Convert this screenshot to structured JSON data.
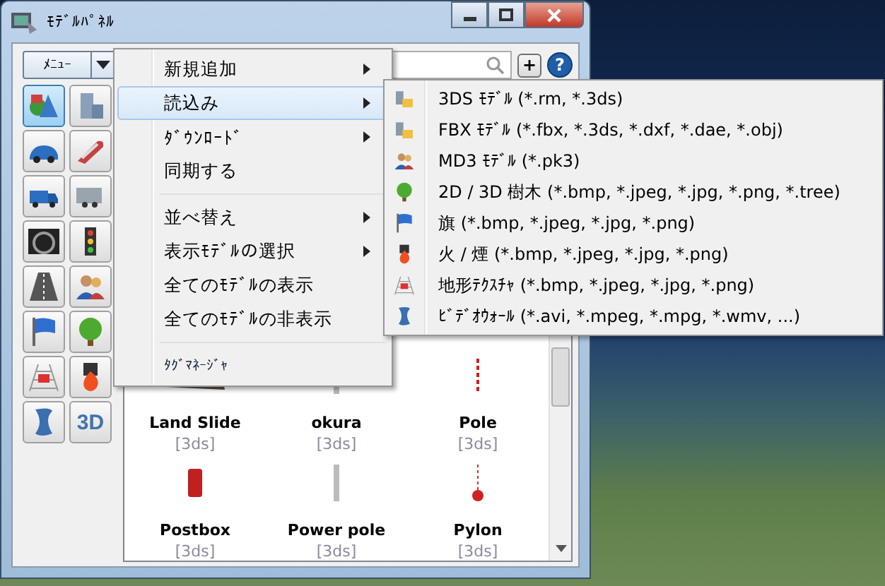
{
  "window": {
    "title": "ﾓﾃﾞﾙﾊﾟﾈﾙ"
  },
  "menu_button": {
    "label": "ﾒﾆｭｰ"
  },
  "toolbar": [
    {
      "selected": true
    },
    {
      "selected": false
    },
    {
      "selected": false
    },
    {
      "selected": false
    },
    {
      "selected": false
    },
    {
      "selected": false
    },
    {
      "selected": false
    },
    {
      "selected": false
    },
    {
      "selected": false
    },
    {
      "selected": false
    },
    {
      "selected": false
    },
    {
      "selected": false
    },
    {
      "selected": false
    },
    {
      "selected": false
    },
    {
      "selected": false
    },
    {
      "selected": false,
      "label": "3D"
    }
  ],
  "search_actions": [
    {
      "label": "+"
    },
    {
      "label": "?"
    }
  ],
  "models": [
    {
      "name": "Land Slide",
      "format": "[3ds]"
    },
    {
      "name": "okura",
      "format": "[3ds]"
    },
    {
      "name": "Pole",
      "format": "[3ds]"
    },
    {
      "name": "Postbox",
      "format": "[3ds]"
    },
    {
      "name": "Power pole",
      "format": "[3ds]"
    },
    {
      "name": "Pylon",
      "format": "[3ds]"
    }
  ],
  "context_menu": [
    {
      "kind": "item",
      "label": "新規追加",
      "submenu": true,
      "selected": false
    },
    {
      "kind": "item",
      "label": "読込み",
      "submenu": true,
      "selected": true
    },
    {
      "kind": "item",
      "label": "ﾀﾞｳﾝﾛｰﾄﾞ",
      "submenu": true,
      "selected": false
    },
    {
      "kind": "item",
      "label": "同期する",
      "submenu": false,
      "selected": false
    },
    {
      "kind": "separator"
    },
    {
      "kind": "item",
      "label": "並べ替え",
      "submenu": true,
      "selected": false
    },
    {
      "kind": "item",
      "label": "表示ﾓﾃﾞﾙの選択",
      "submenu": true,
      "selected": false
    },
    {
      "kind": "item",
      "label": "全てのﾓﾃﾞﾙの表示",
      "submenu": false,
      "selected": false
    },
    {
      "kind": "item",
      "label": "全てのﾓﾃﾞﾙの非表示",
      "submenu": false,
      "selected": false
    },
    {
      "kind": "separator"
    },
    {
      "kind": "small",
      "label": "ﾀｸﾞﾏﾈｰｼﾞｬ",
      "submenu": false,
      "selected": false
    }
  ],
  "submenu": [
    {
      "label": "3DS ﾓﾃﾞﾙ (*.rm, *.3ds)"
    },
    {
      "label": "FBX ﾓﾃﾞﾙ (*.fbx, *.3ds, *.dxf, *.dae, *.obj)"
    },
    {
      "label": "MD3 ﾓﾃﾞﾙ (*.pk3)"
    },
    {
      "label": "2D / 3D 樹木 (*.bmp, *.jpeg, *.jpg, *.png, *.tree)"
    },
    {
      "label": "旗 (*.bmp, *.jpeg, *.jpg, *.png)"
    },
    {
      "label": "火 / 煙 (*.bmp, *.jpeg, *.jpg, *.png)"
    },
    {
      "label": "地形ﾃｸｽﾁｬ (*.bmp, *.jpeg, *.jpg, *.png)"
    },
    {
      "label": "ﾋﾞﾃﾞｵｳｫｰﾙ (*.avi, *.mpeg, *.mpg, *.wmv, ...)"
    }
  ]
}
